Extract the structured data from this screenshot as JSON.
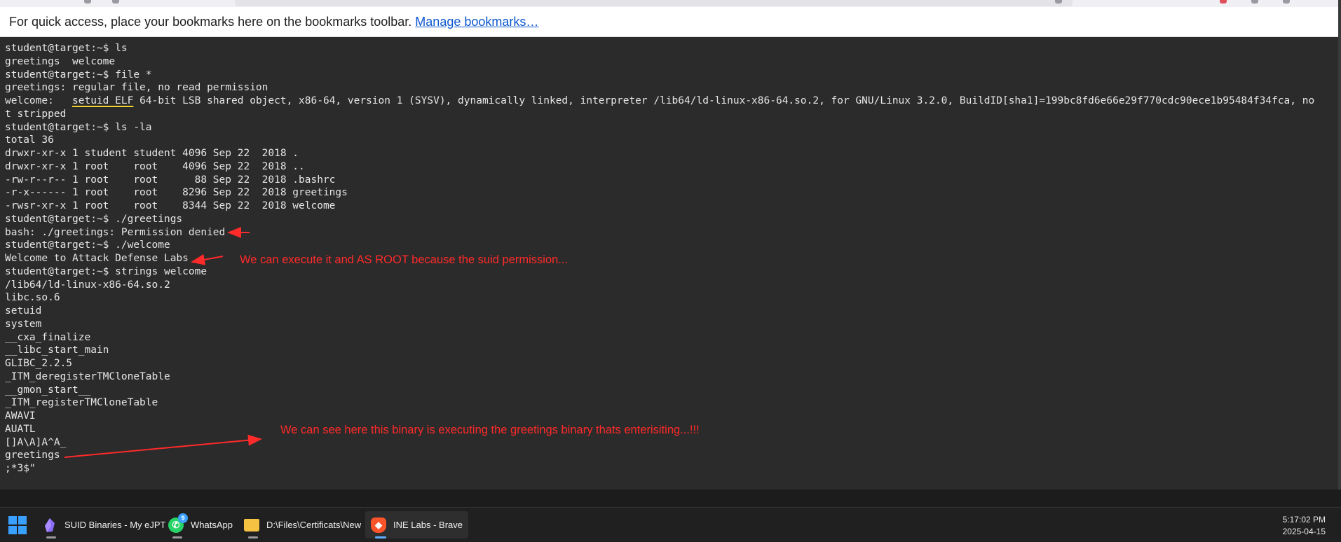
{
  "bookmarks_bar": {
    "text": "For quick access, place your bookmarks here on the bookmarks toolbar.",
    "link": "Manage bookmarks…"
  },
  "terminal": {
    "lines": [
      "student@target:~$ ls",
      "greetings  welcome",
      "student@target:~$ file *",
      "greetings: regular file, no read permission",
      {
        "pre": "welcome:   ",
        "hl": "setuid ELF",
        "post": " 64-bit LSB shared object, x86-64, version 1 (SYSV), dynamically linked, interpreter /lib64/ld-linux-x86-64.so.2, for GNU/Linux 3.2.0, BuildID[sha1]=199bc8fd6e66e29f770cdc90ece1b95484f34fca, no"
      },
      "t stripped",
      "student@target:~$ ls -la",
      "total 36",
      "drwxr-xr-x 1 student student 4096 Sep 22  2018 .",
      "drwxr-xr-x 1 root    root    4096 Sep 22  2018 ..",
      "-rw-r--r-- 1 root    root      88 Sep 22  2018 .bashrc",
      "-r-x------ 1 root    root    8296 Sep 22  2018 greetings",
      "-rwsr-xr-x 1 root    root    8344 Sep 22  2018 welcome",
      "student@target:~$ ./greetings",
      "bash: ./greetings: Permission denied",
      "student@target:~$ ./welcome",
      "Welcome to Attack Defense Labs",
      "student@target:~$ strings welcome",
      "/lib64/ld-linux-x86-64.so.2",
      "libc.so.6",
      "setuid",
      "system",
      "__cxa_finalize",
      "__libc_start_main",
      "GLIBC_2.2.5",
      "_ITM_deregisterTMCloneTable",
      "__gmon_start__",
      "_ITM_registerTMCloneTable",
      "AWAVI",
      "AUATL",
      "[]A\\A]A^A_",
      "greetings",
      ";*3$\""
    ]
  },
  "annotations": {
    "suid_note": "We can execute it and AS ROOT because the suid permission...",
    "binary_note": "We can see here this binary is executing the greetings binary thats enterisiting...!!!",
    "color": "#ff2a2a"
  },
  "taskbar": {
    "items": [
      {
        "label": "SUID Binaries - My eJPT",
        "icon": "obsidian-icon"
      },
      {
        "label": "WhatsApp",
        "icon": "whatsapp-icon",
        "badge": "9"
      },
      {
        "label": "D:\\Files\\Certificats\\New",
        "icon": "folder-icon"
      },
      {
        "label": "INE Labs - Brave",
        "icon": "brave-icon",
        "active": true
      }
    ],
    "time": "5:17:02 PM",
    "date": "2025-04-15"
  }
}
